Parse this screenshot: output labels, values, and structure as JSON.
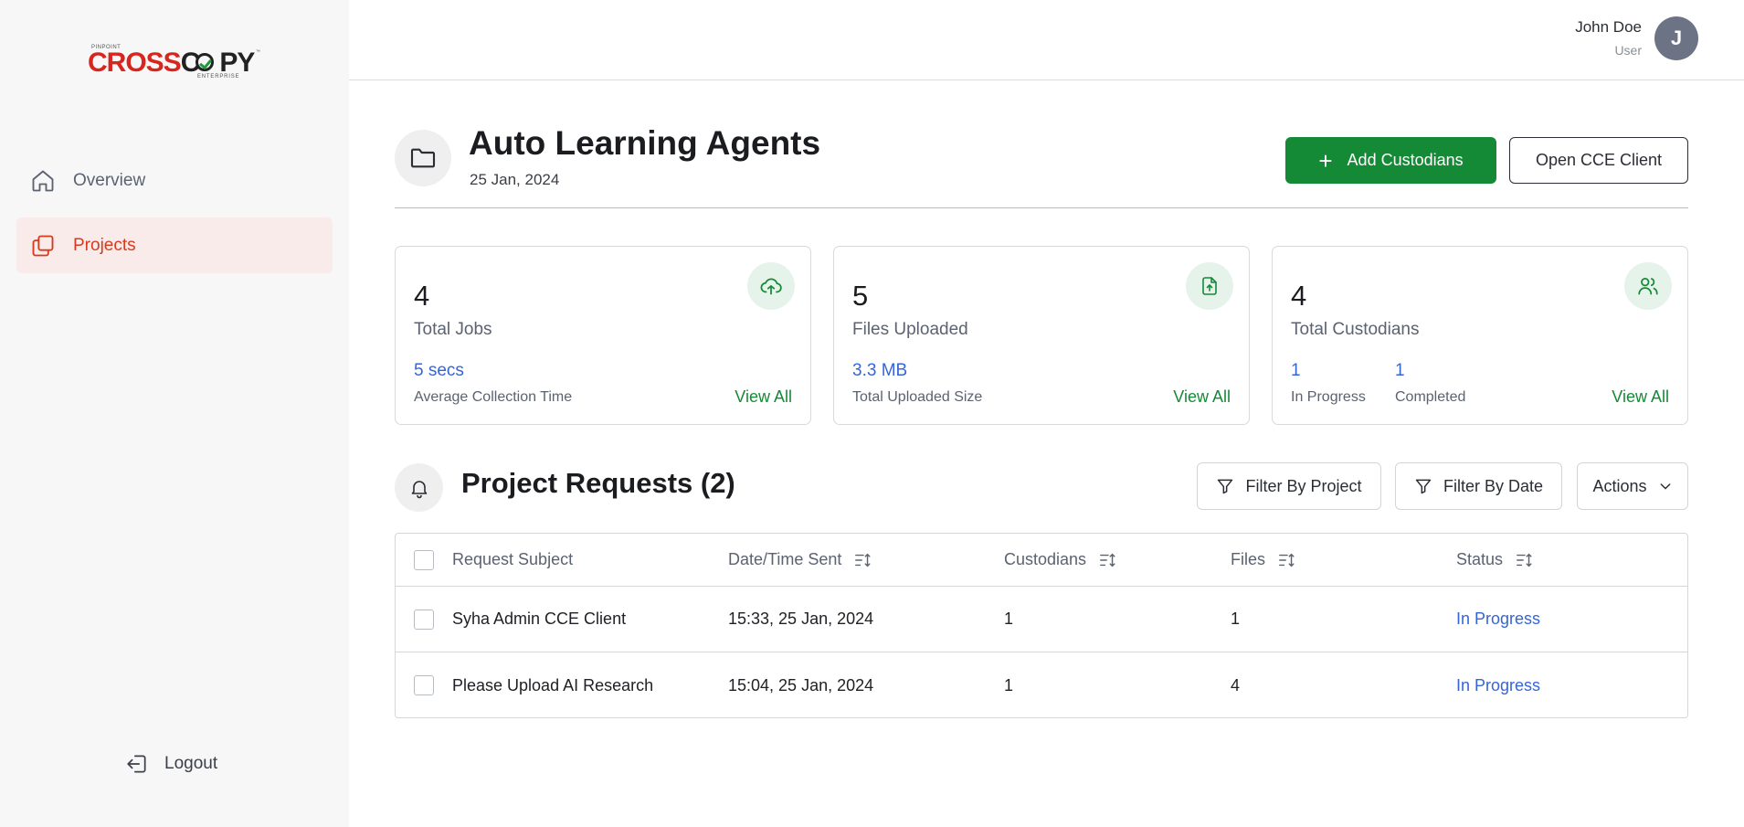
{
  "brand": {
    "logo_top": "PINPOINT",
    "logo_red": "CROSS",
    "logo_dark": "C",
    "logo_dark2": "PY",
    "logo_bottom": "ENTERPRISE",
    "logo_tm": "™",
    "primary_color": "#158a36",
    "accent_color": "#d83a1e",
    "link_color": "#3565d8"
  },
  "sidebar": {
    "items": [
      {
        "label": "Overview",
        "icon": "home-icon",
        "active": false
      },
      {
        "label": "Projects",
        "icon": "projects-icon",
        "active": true
      }
    ],
    "logout_label": "Logout"
  },
  "user": {
    "name": "John Doe",
    "role": "User",
    "initial": "J"
  },
  "project": {
    "title": "Auto Learning Agents",
    "date": "25 Jan, 2024",
    "add_button": "Add Custodians",
    "open_button": "Open CCE Client"
  },
  "stats": [
    {
      "value": "4",
      "label": "Total Jobs",
      "icon": "cloud-upload-icon",
      "sub_value": "5 secs",
      "sub_label": "Average Collection Time",
      "view_all": "View All"
    },
    {
      "value": "5",
      "label": "Files Uploaded",
      "icon": "file-upload-icon",
      "sub_value": "3.3 MB",
      "sub_label": "Total Uploaded Size",
      "view_all": "View All"
    },
    {
      "value": "4",
      "label": "Total Custodians",
      "icon": "users-icon",
      "in_progress_value": "1",
      "in_progress_label": "In Progress",
      "completed_value": "1",
      "completed_label": "Completed",
      "view_all": "View All"
    }
  ],
  "requests": {
    "title": "Project Requests (2)",
    "filter_project": "Filter By Project",
    "filter_date": "Filter By Date",
    "actions": "Actions",
    "columns": [
      "Request Subject",
      "Date/Time Sent",
      "Custodians",
      "Files",
      "Status"
    ],
    "rows": [
      {
        "subject": "Syha Admin CCE Client",
        "sent": "15:33, 25 Jan, 2024",
        "custodians": "1",
        "files": "1",
        "status": "In Progress"
      },
      {
        "subject": "Please Upload AI Research",
        "sent": "15:04, 25 Jan, 2024",
        "custodians": "1",
        "files": "4",
        "status": "In Progress"
      }
    ]
  }
}
